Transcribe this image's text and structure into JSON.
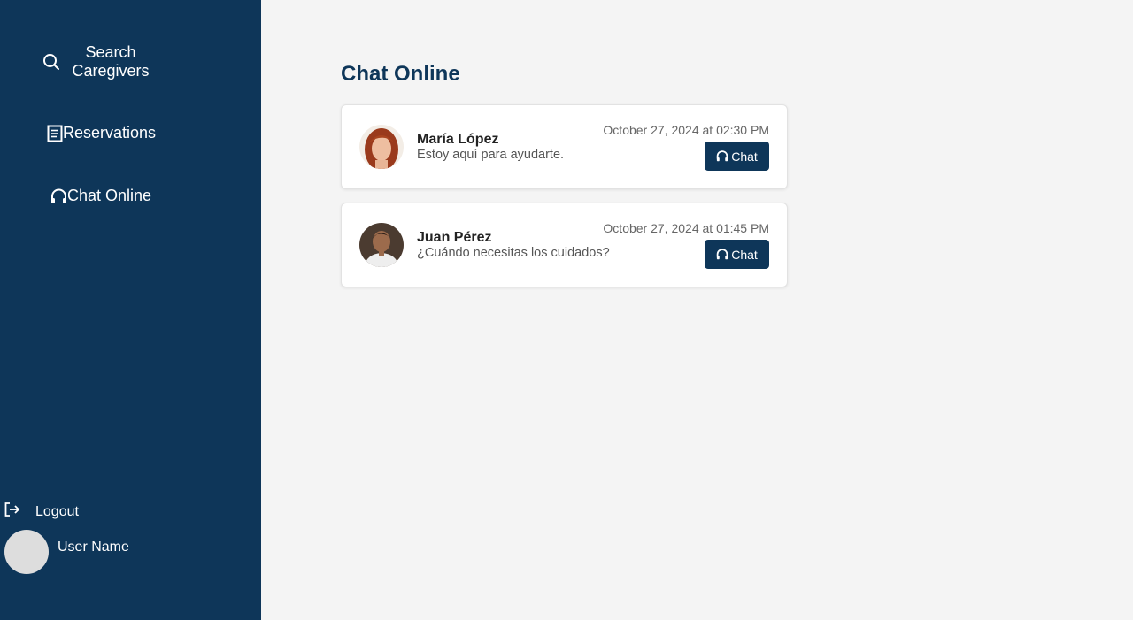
{
  "sidebar": {
    "nav": [
      {
        "label": "Search Caregivers",
        "icon": "search-icon"
      },
      {
        "label": "Reservations",
        "icon": "document-icon"
      },
      {
        "label": "Chat Online",
        "icon": "headset-icon"
      }
    ],
    "logout_label": "Logout",
    "user_name": "User Name"
  },
  "main": {
    "title": "Chat Online",
    "chats": [
      {
        "name": "María López",
        "message": "Estoy aquí para ayudarte.",
        "timestamp": "October 27, 2024 at 02:30 PM",
        "button_label": "Chat"
      },
      {
        "name": "Juan Pérez",
        "message": "¿Cuándo necesitas los cuidados?",
        "timestamp": "October 27, 2024 at 01:45 PM",
        "button_label": "Chat"
      }
    ]
  },
  "colors": {
    "primary": "#0e3659",
    "background": "#f4f4f4",
    "card": "#ffffff"
  }
}
